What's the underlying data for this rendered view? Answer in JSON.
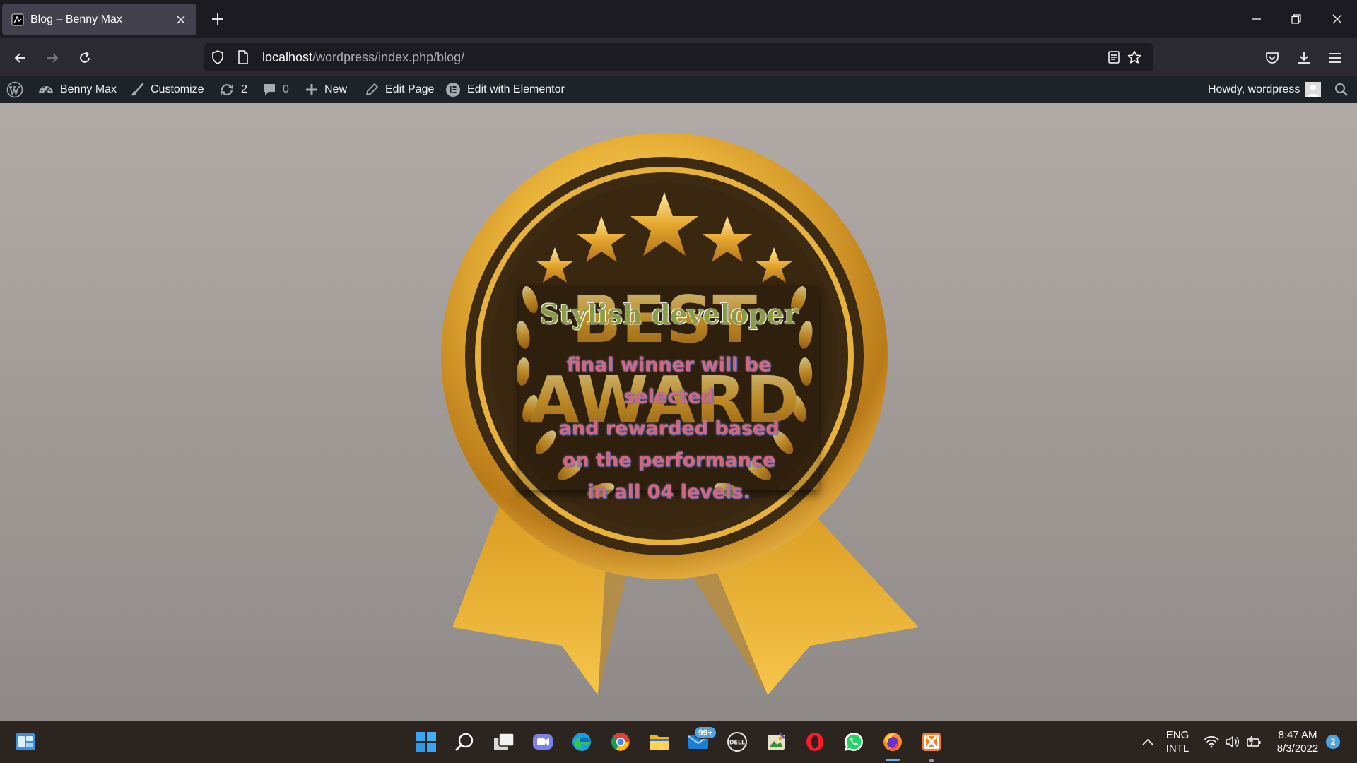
{
  "browser": {
    "tab_title": "Blog – Benny Max",
    "url_host": "localhost",
    "url_path": "/wordpress/index.php/blog/"
  },
  "admin_bar": {
    "site_name": "Benny Max",
    "customize": "Customize",
    "updates_count": "2",
    "comments_count": "0",
    "new_label": "New",
    "edit_page": "Edit Page",
    "edit_elementor": "Edit with Elementor",
    "howdy": "Howdy, wordpress"
  },
  "award": {
    "title": "Stylish developer",
    "lines": [
      "final winner will be",
      "selected",
      "and rewarded based",
      "on the performance",
      "in all 04 levels."
    ],
    "medal_text_top": "BEST",
    "medal_text_bottom": "AWARD"
  },
  "taskbar": {
    "mail_badge": "99+",
    "language": "ENG",
    "layout": "INTL",
    "time": "8:47 AM",
    "date": "8/3/2022",
    "notifications": "2"
  },
  "colors": {
    "browser_bg": "#1c1b22",
    "toolbar_bg": "#2b2a33",
    "admin_bar_bg": "#1d2327",
    "taskbar_bg": "#2c241e",
    "gold": "#f2b93b",
    "medal_dark": "#3d2a12"
  }
}
